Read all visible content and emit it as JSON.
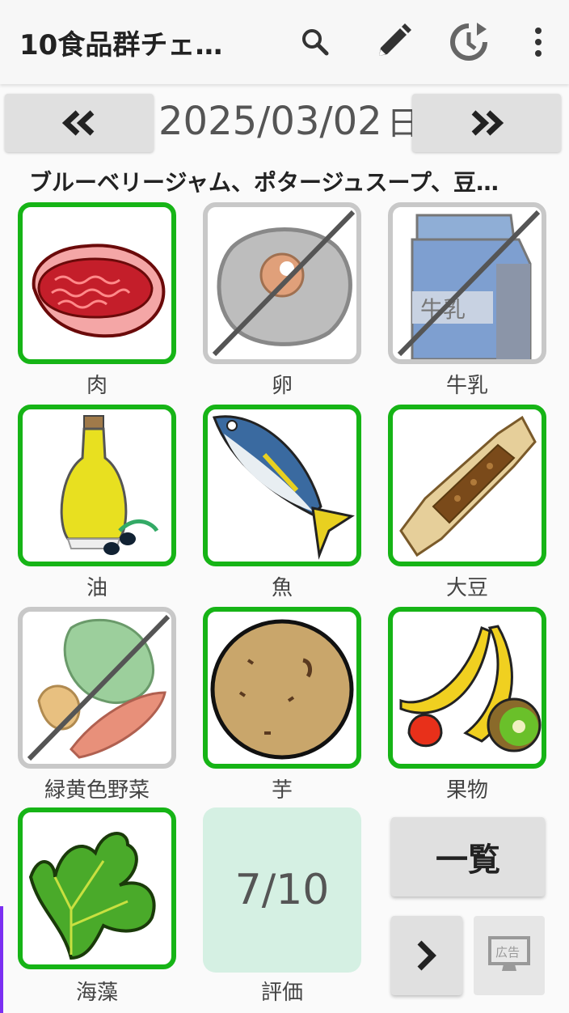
{
  "appbar": {
    "title": "10食品群チェ…",
    "icons": [
      "search-icon",
      "edit-icon",
      "history-icon",
      "more-vert-icon"
    ]
  },
  "date_nav": {
    "prev_label": "«",
    "next_label": "»",
    "date": "2025/03/02",
    "weekday": "日"
  },
  "menu_summary": "ブルーベリージャム、ポタージュスープ、豆…",
  "food_groups": [
    {
      "label": "肉",
      "eaten": true
    },
    {
      "label": "卵",
      "eaten": false
    },
    {
      "label": "牛乳",
      "eaten": false
    },
    {
      "label": "油",
      "eaten": true
    },
    {
      "label": "魚",
      "eaten": true
    },
    {
      "label": "大豆",
      "eaten": true
    },
    {
      "label": "緑黄色野菜",
      "eaten": false
    },
    {
      "label": "芋",
      "eaten": true
    },
    {
      "label": "果物",
      "eaten": true
    },
    {
      "label": "海藻",
      "eaten": true
    }
  ],
  "milk_carton_text": "牛乳",
  "score": {
    "value": "7/10",
    "label": "評価"
  },
  "buttons": {
    "list": "一覧",
    "ad_label": "広告"
  },
  "colors": {
    "eaten_border": "#16b416",
    "not_eaten_border": "#c8c8c8",
    "score_bg": "#d5f0e3"
  }
}
